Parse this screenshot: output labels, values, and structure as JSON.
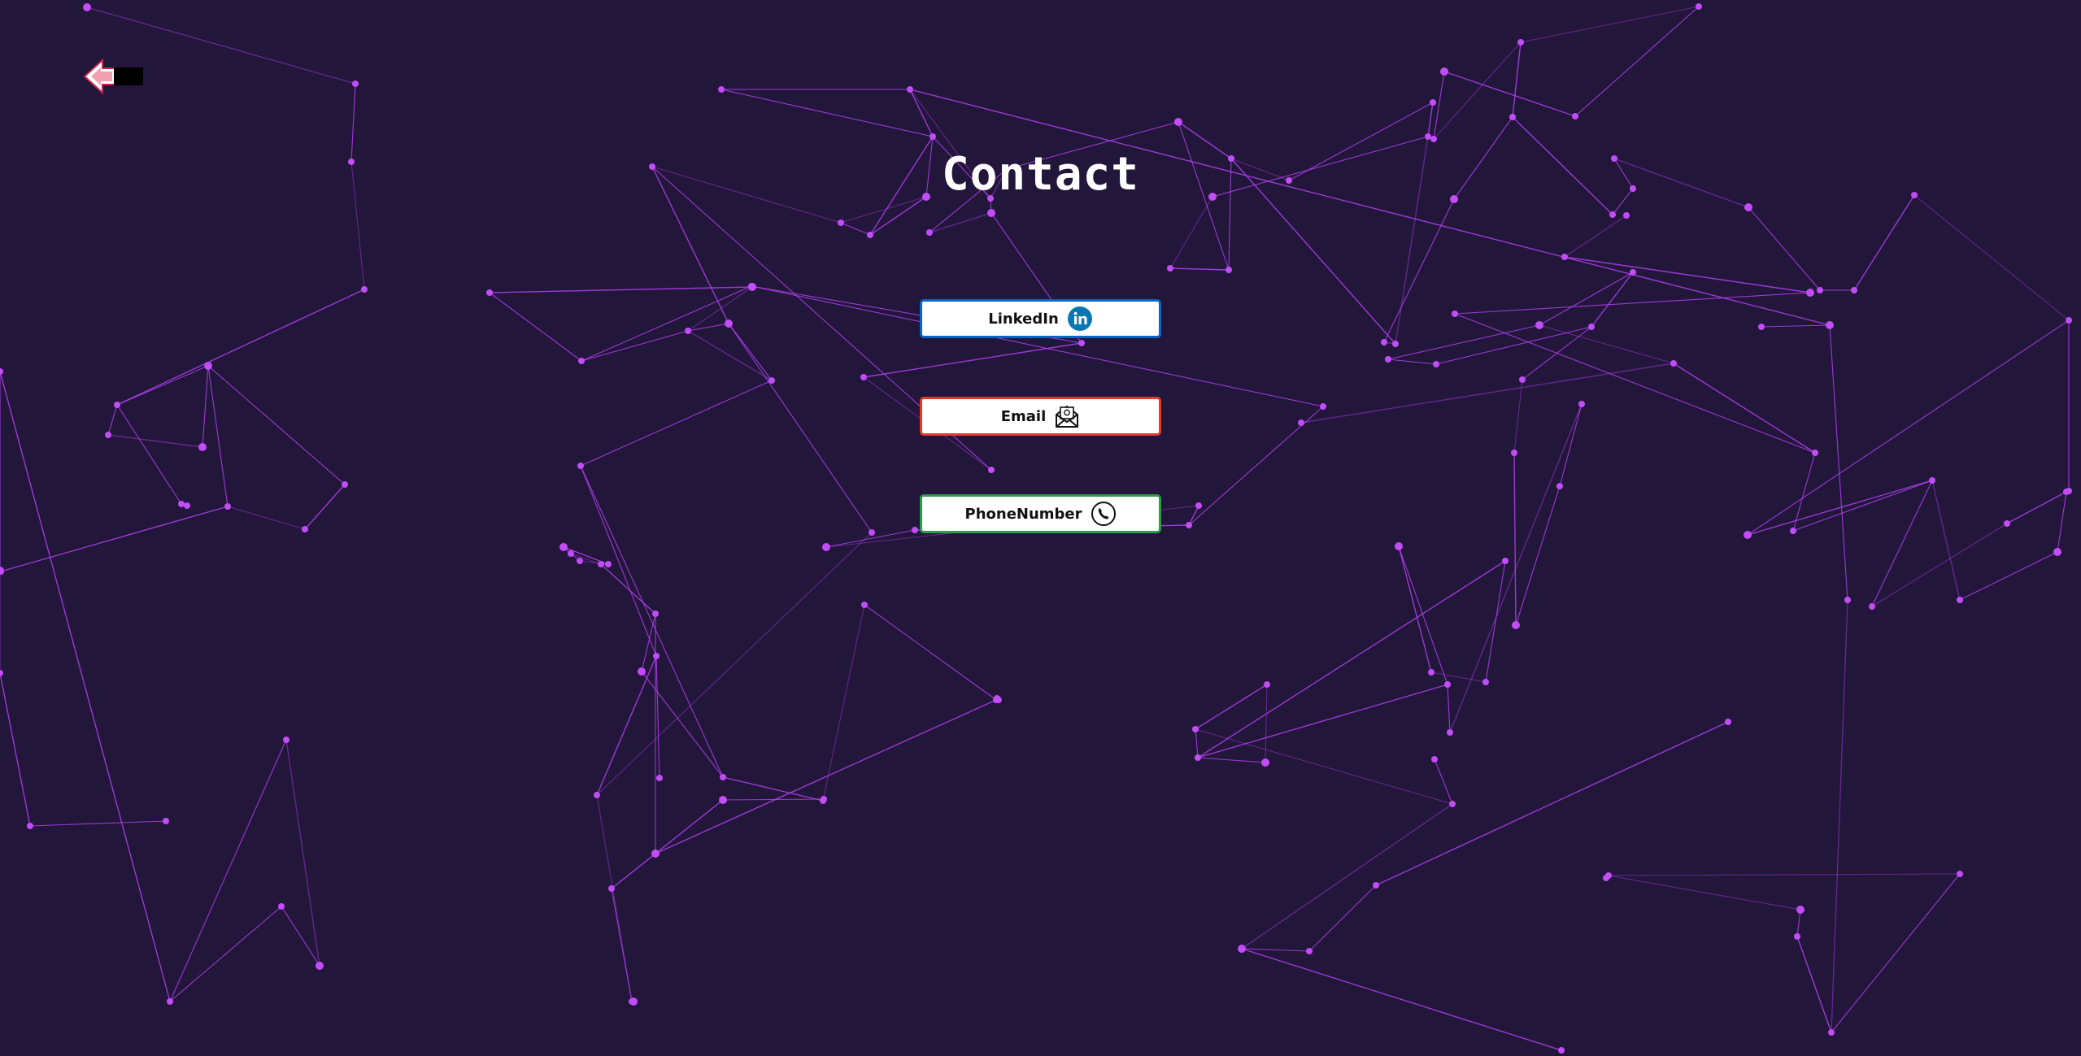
{
  "page": {
    "title": "Contact"
  },
  "nav": {
    "back_icon": "pixel-arrow-left-icon"
  },
  "contacts": [
    {
      "label": "LinkedIn",
      "icon": "linkedin-icon",
      "accent": "#0a66c2"
    },
    {
      "label": "Email",
      "icon": "envelope-at-icon",
      "accent": "#e23b2e"
    },
    {
      "label": "PhoneNumber",
      "icon": "phone-icon",
      "accent": "#2e9b4a"
    }
  ],
  "colors": {
    "background": "#22163a",
    "network": "#b13ff0",
    "text": "#ffffff"
  }
}
